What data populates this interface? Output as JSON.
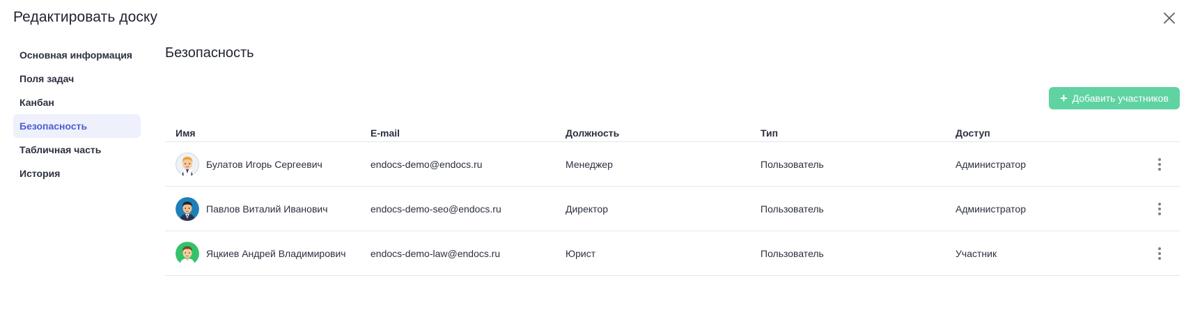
{
  "modal": {
    "title": "Редактировать доску"
  },
  "sidebar": {
    "items": [
      {
        "label": "Основная информация",
        "active": false
      },
      {
        "label": "Поля задач",
        "active": false
      },
      {
        "label": "Канбан",
        "active": false
      },
      {
        "label": "Безопасность",
        "active": true
      },
      {
        "label": "Табличная часть",
        "active": false
      },
      {
        "label": "История",
        "active": false
      }
    ]
  },
  "section": {
    "title": "Безопасность"
  },
  "toolbar": {
    "add_label": "Добавить участников",
    "add_icon": "plus-icon"
  },
  "table": {
    "headers": {
      "name": "Имя",
      "email": "E-mail",
      "position": "Должность",
      "type": "Тип",
      "access": "Доступ"
    },
    "rows": [
      {
        "name": "Булатов Игорь Сергеевич",
        "email": "endocs-demo@endocs.ru",
        "position": "Менеджер",
        "type": "Пользователь",
        "access": "Администратор",
        "avatar": "avatar-blond-man"
      },
      {
        "name": "Павлов Виталий Иванович",
        "email": "endocs-demo-seo@endocs.ru",
        "position": "Директор",
        "type": "Пользователь",
        "access": "Администратор",
        "avatar": "avatar-suit-man"
      },
      {
        "name": "Яцкиев Андрей Владимирович",
        "email": "endocs-demo-law@endocs.ru",
        "position": "Юрист",
        "type": "Пользователь",
        "access": "Участник",
        "avatar": "avatar-green-man"
      }
    ]
  },
  "colors": {
    "accent": "#4b5fd1",
    "active_bg": "#eef0fb",
    "add_button": "#5fd3a1"
  }
}
